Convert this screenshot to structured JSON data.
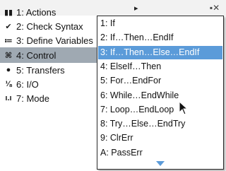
{
  "main_menu": {
    "items": [
      {
        "number": "1",
        "label": "1: Actions",
        "icon": "actions-icon",
        "icon_glyph": "▮▮"
      },
      {
        "number": "2",
        "label": "2: Check Syntax",
        "icon": "check-syntax-icon",
        "icon_glyph": "✔"
      },
      {
        "number": "3",
        "label": "3: Define Variables",
        "icon": "define-variables-icon",
        "icon_glyph": "≔"
      },
      {
        "number": "4",
        "label": "4: Control",
        "icon": "control-icon",
        "icon_glyph": "⌘"
      },
      {
        "number": "5",
        "label": "5: Transfers",
        "icon": "transfers-icon",
        "icon_glyph": "●"
      },
      {
        "number": "6",
        "label": "6: I/O",
        "icon": "io-icon",
        "icon_glyph": "⅛"
      },
      {
        "number": "7",
        "label": "7: Mode",
        "icon": "mode-icon",
        "icon_glyph": "ı.ı"
      }
    ],
    "selected_index": 3
  },
  "sub_menu": {
    "items": [
      "1: If",
      "2: If…Then…EndIf",
      "3: If…Then…Else…EndIf",
      "4: ElseIf…Then",
      "5: For…EndFor",
      "6: While…EndWhile",
      "7: Loop…EndLoop",
      "8: Try…Else…EndTry",
      "9: ClrErr",
      "A: PassErr"
    ],
    "selected_index": 2,
    "scroll_indicator": "chevron-down-icon"
  },
  "status": {
    "window_control": "▪✕"
  },
  "colors": {
    "highlight_submenu": "#5b9bd9",
    "highlight_main": "#9fa9b2"
  }
}
